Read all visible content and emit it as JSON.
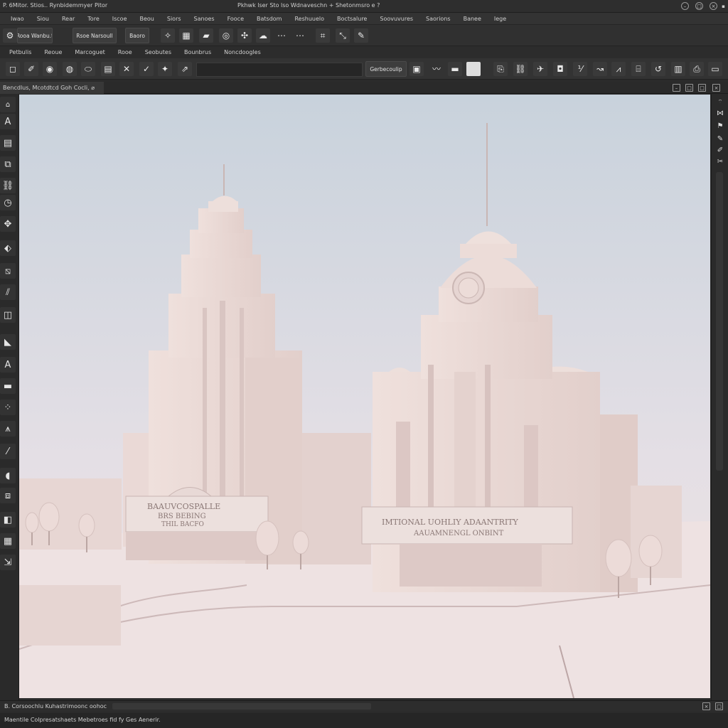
{
  "titlebar": {
    "left": "P. 6Mitor. Stios.. Rynbidemmyer Pitor",
    "center": "Pkhwk lser  Sto lso Wdnaveschn  +  Shetonmsro  e  ?"
  },
  "menubar": {
    "items": [
      "Iwao",
      "Siou",
      "Rear",
      "Tore",
      "Iscoe",
      "Beou",
      "Siors",
      "Sanoes",
      "Fooce",
      "Batsdom",
      "Reshuuelo",
      "Boctsalure",
      "Soovuvures",
      "Saorions",
      "Banee",
      "Iege"
    ]
  },
  "toolbar1": {
    "buttons": [
      "Rooa Wanbu.t",
      "Rsoe Narsoull",
      "Baoro"
    ]
  },
  "tabbar2": {
    "items": [
      "Petbulis",
      "Reoue",
      "Marcoguet",
      "Rooe",
      "Seobutes",
      "Bounbrus",
      "Noncdoogles"
    ]
  },
  "toolbar2": {
    "dropdown_label": "Gerbecoulip"
  },
  "document": {
    "tab_label": "Bencdlus, Mcotdtcd Goh Cocli, ⌀"
  },
  "scene": {
    "left_sign_line1": "BAAUVCOSPALLE",
    "left_sign_line2": "BRS BEBING",
    "left_sign_line3": "THIL BACFO",
    "right_sign_line1": "IMTIONAL  UOHLIY  ADAANTRITY",
    "right_sign_line2": "AAUAMNENGL  ONBINT",
    "sky_top": "#c9d2dc",
    "sky_bottom": "#eee2e2",
    "building": "#ecdcd8",
    "building_shadow": "#d9c4c1",
    "ground": "#efe3e3"
  },
  "statusbar": {
    "text": "B. Corsoochlu Kuhastrimoonc  oohoc"
  },
  "footer": {
    "text": "Maentile  Colpresatshaets  Mebetroes  fid  fy  Ges  Aenerir."
  },
  "icons": {
    "left_tools": [
      "select-icon",
      "text-icon",
      "panel-icon",
      "node-icon",
      "link-icon",
      "clock-icon",
      "move-icon",
      "brush-icon",
      "bandage-icon",
      "ruler-icon",
      "layers-icon",
      "pointer-icon",
      "type-icon",
      "film-icon",
      "grid-icon",
      "compass-icon",
      "line-icon",
      "paint-icon",
      "group-icon",
      "frame-icon",
      "align-icon",
      "export-icon"
    ],
    "right_tools": [
      "wifi-icon",
      "bowtie-icon",
      "flag-icon",
      "pen-icon",
      "pencil-icon",
      "scissor-icon"
    ]
  }
}
